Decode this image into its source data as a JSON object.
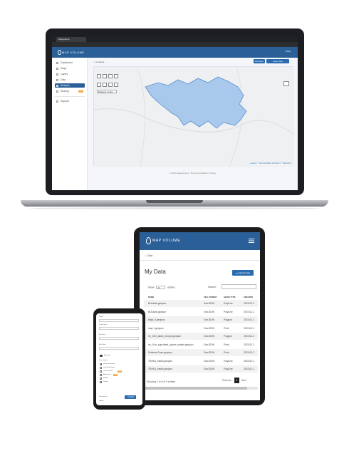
{
  "laptop": {
    "browser_tab": "Mapvolume",
    "address": "• Mapvolume  • mapvolume.io/polka",
    "brand": "MAP VOLUME",
    "user": "Vitaly",
    "sidebar": [
      {
        "label": "Dashboard",
        "icon": "dashboard-icon"
      },
      {
        "label": "Maps",
        "icon": "map-icon"
      },
      {
        "label": "Layers",
        "icon": "layers-icon"
      },
      {
        "label": "Data",
        "icon": "data-icon"
      },
      {
        "label": "Analysis",
        "icon": "analysis-icon",
        "active": true
      },
      {
        "label": "Sharing",
        "icon": "share-icon",
        "badge": "PRO"
      },
      {
        "label": "Support",
        "icon": "support-icon"
      }
    ],
    "breadcrumb": "⌂ / Analysis",
    "buttons": {
      "btn1": "Add layer",
      "btn2": "Save view"
    },
    "layer_label": "Polygon ▾ / 1 item",
    "attribution": "● Leaflet | © OpenStreetMap contributors | © MapVolume",
    "footer": "© 2023 mapvolume.io • Terms & Conditions • Privacy"
  },
  "tablet": {
    "brand": "MAP VOLUME",
    "breadcrumb": "⌂ / Data",
    "title": "My Data",
    "upload_label": "☁ Upload data",
    "show_label": "Show",
    "show_value": "10",
    "entries_label": "entries",
    "search_label": "Search:",
    "columns": [
      "NAME",
      "FILE FORMAT",
      "GEOM TYPE",
      "CREATED"
    ],
    "rows": [
      [
        "BULdata.geojson",
        "GeoJSON",
        "PolyLine",
        "2023-02-2"
      ],
      [
        "BULdata.geojson",
        "GeoJSON",
        "PolyLine",
        "2023-02-2"
      ],
      [
        "bulgr_d.geojson",
        "GeoJSON",
        "Polygon",
        "2023-02-2"
      ],
      [
        "map 1.geojson",
        "GeoJSON",
        "Point",
        "2023-02-2"
      ],
      [
        "ne_10m_lakes_europe.geojson",
        "GeoJSON",
        "Polygon",
        "2023-02-2"
      ],
      [
        "ne_10m_populated_places_simple.geojson",
        "GeoJSON",
        "Point",
        "2023-02-2"
      ],
      [
        "Svishtov-Ruse.geojson",
        "GeoJSON",
        "Point",
        "2023-02-2"
      ],
      [
        "TRAKA_tracks.geojson",
        "GeoJSON",
        "PolyLine",
        "2023-02-2"
      ],
      [
        "TRAKA_tracks.geojson",
        "GeoJSON",
        "PolyLine",
        "2023-02-2"
      ]
    ],
    "info": "Showing 1 to 9 of 9 entries",
    "prev": "Previous",
    "page": "1",
    "next": "Next"
  },
  "phone": {
    "labels": [
      "Name",
      "Geom type",
      "Show list",
      "Edit fields",
      "Attributes",
      "Show labels",
      "Data format",
      "Labels"
    ],
    "options": [
      "Show all features",
      "Use filter/fill data",
      "Cluster points",
      "Add search",
      "Hidden",
      "Popup"
    ],
    "save_label": "+ Upload",
    "footer": "Lorem"
  },
  "colors": {
    "brand": "#2b5f98",
    "accent": "#2b6cb0",
    "lake": "#a8c8ec"
  }
}
